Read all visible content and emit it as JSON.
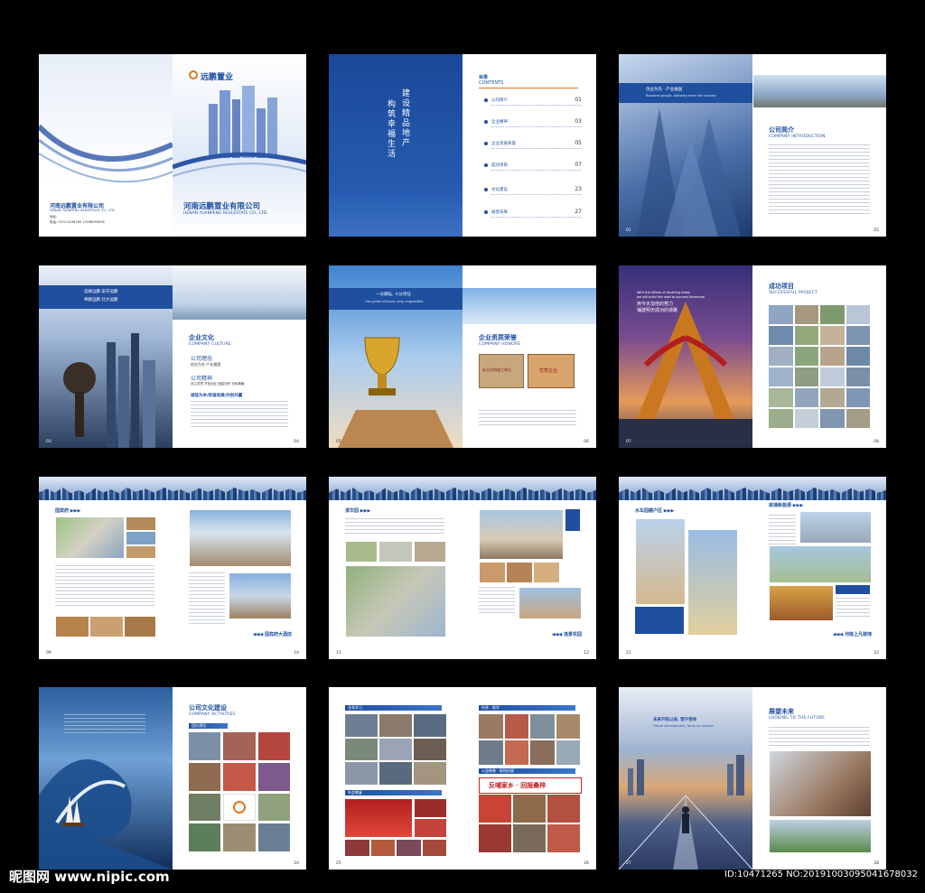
{
  "cover": {
    "brand": "远鹏置业",
    "company_cn": "河南远鹏置业有限公司",
    "company_en": "HENAN YUANPENG REALESTATE CO., LTD.",
    "company_cn_small": "河南远鹏置业有限公司",
    "company_en_small": "HENAN YUANPENG REALESTATE CO., LTD.",
    "address_label": "地址:",
    "phone_label": "电话:",
    "phone_value": "0372-6198789 13598095096"
  },
  "toc": {
    "slogan_1": "建设精品地产",
    "slogan_2": "构筑幸福生活",
    "title_cn": "目录",
    "title_en": "CONTENTS",
    "items": [
      {
        "label": "公司简介",
        "page": "01"
      },
      {
        "label": "企业精神",
        "page": "03"
      },
      {
        "label": "企业资质荣誉",
        "page": "05"
      },
      {
        "label": "成功项目",
        "page": "07"
      },
      {
        "label": "文化建设",
        "page": "23"
      },
      {
        "label": "展望未来",
        "page": "27"
      }
    ]
  },
  "intro": {
    "banner_cn": "创业为先 · 产业报国",
    "banner_en": "Business people, industry serve the country",
    "title_cn": "公司简介",
    "title_en": "COMPANY INTRODUCTION",
    "page_l": "01",
    "page_r": "02"
  },
  "culture": {
    "slogan_1": "选择远鹏  安守远鹏",
    "slogan_2": "奉献远鹏  壮大远鹏",
    "title_cn": "企业文化",
    "title_en": "COMPANY CULTURE",
    "idea_title": "公司理念",
    "idea_text": "创业为先  产业报国",
    "spirit_title": "公司精神",
    "spirit_text": "自立意思  开拓创业  团结协作  无私奉献",
    "motto": "诚信为本/和谐发展/共创共赢",
    "page_l": "03",
    "page_r": "04"
  },
  "honors": {
    "banner_cn": "一分耕耘, 十分责任",
    "banner_en": "One point of honor, very responsible",
    "title_cn": "企业资质荣誉",
    "title_en": "COMPANY HONORS",
    "cert_1": "安全文明施工单位",
    "cert_2": "优秀企业",
    "page_l": "05",
    "page_r": "06"
  },
  "projects": {
    "banner_en_1": "With the efforts of doubling today",
    "banner_en_2": "we will build the road to success tomorrow",
    "banner_cn": "用今天加倍的努力\n铺建明天成功的道路",
    "title_cn": "成功项目",
    "title_en": "SUCCESSFUL PROJECT",
    "page_l": "07",
    "page_r": "08"
  },
  "p09": {
    "tag": "国宾府",
    "caption": "国宾府大酒店",
    "page_l": "09",
    "page_r": "10"
  },
  "p11": {
    "tag": "清华园",
    "caption": "逸景花园",
    "page_l": "11",
    "page_r": "12"
  },
  "p21": {
    "tag": "水车园棚户区",
    "tag2": "就通新能源",
    "caption": "河南上凡装饰",
    "page_l": "21",
    "page_r": "22"
  },
  "activities": {
    "title_cn": "公司文化建设",
    "title_en": "COMPANY ACTIVITIES",
    "section": "团队建设",
    "page_l": "24"
  },
  "p25": {
    "sec_1": "业务学习",
    "sec_2": "年会晚宴",
    "sec_3": "扶贫 · 助学",
    "sec_4": "公益慈善 · 助残扶弱",
    "banner_text": "反哺家乡 · 回报桑梓",
    "page_l": "25",
    "page_r": "26"
  },
  "future": {
    "banner_cn": "未来开拓以进, 塑于使命",
    "banner_en": "Future development, focus on mission",
    "title_cn": "展望未来",
    "title_en": "LOOKING TO THE FUTURE",
    "page_l": "27",
    "page_r": "28"
  },
  "watermark": {
    "left": "昵图网 www.nipic.com",
    "right": "ID:10471265 NO:20191003095041678032"
  },
  "colors": {
    "brand_blue": "#1f4f9e",
    "accent_orange": "#e8751a"
  }
}
